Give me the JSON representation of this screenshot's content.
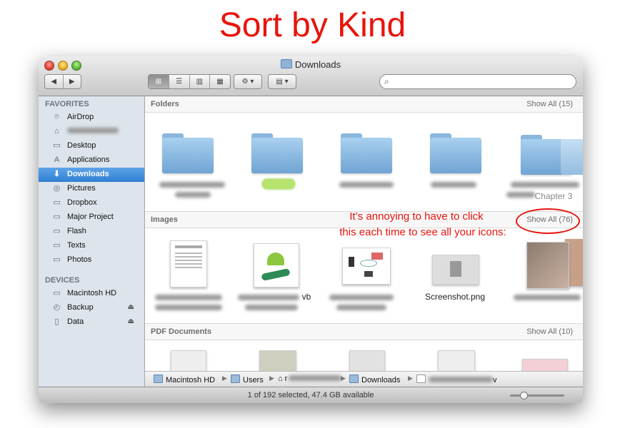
{
  "headline": "Sort by Kind",
  "window": {
    "title": "Downloads"
  },
  "search": {
    "placeholder": ""
  },
  "sidebar": {
    "favorites_header": "FAVORITES",
    "devices_header": "DEVICES",
    "favorites": [
      {
        "label": "AirDrop",
        "icon": "airdrop-icon"
      },
      {
        "label": "",
        "icon": "home-icon"
      },
      {
        "label": "Desktop",
        "icon": "desktop-icon"
      },
      {
        "label": "Applications",
        "icon": "applications-icon"
      },
      {
        "label": "Downloads",
        "icon": "downloads-icon",
        "selected": true
      },
      {
        "label": "Pictures",
        "icon": "pictures-icon"
      },
      {
        "label": "Dropbox",
        "icon": "folder-icon"
      },
      {
        "label": "Major Project",
        "icon": "folder-icon"
      },
      {
        "label": "Flash",
        "icon": "folder-icon"
      },
      {
        "label": "Texts",
        "icon": "folder-icon"
      },
      {
        "label": "Photos",
        "icon": "folder-icon"
      }
    ],
    "devices": [
      {
        "label": "Macintosh HD",
        "icon": "hard-drive-icon"
      },
      {
        "label": "Backup",
        "icon": "time-machine-icon",
        "eject": true
      },
      {
        "label": "Data",
        "icon": "drive-icon",
        "eject": true
      }
    ]
  },
  "sections": {
    "folders": {
      "title": "Folders",
      "show_all": "Show All (15)"
    },
    "images": {
      "title": "Images",
      "show_all": "Show All (76)"
    },
    "pdf": {
      "title": "PDF Documents",
      "show_all": "Show All (10)"
    }
  },
  "folders": {
    "partial_caption": "Chapter 3"
  },
  "images": {
    "caption_vb": "vb",
    "screenshot_caption": "Screenshot.png"
  },
  "annotation": {
    "line1": "It’s annoying to have to click",
    "line2": "this each time to see all your icons:"
  },
  "pathbar": {
    "items": [
      "Macintosh HD",
      "Users",
      "r",
      "Downloads",
      "v"
    ]
  },
  "status": {
    "text": "1 of 192 selected, 47.4 GB available"
  },
  "colors": {
    "annotation": "#e8140c",
    "selection": "#2f7fd3"
  }
}
